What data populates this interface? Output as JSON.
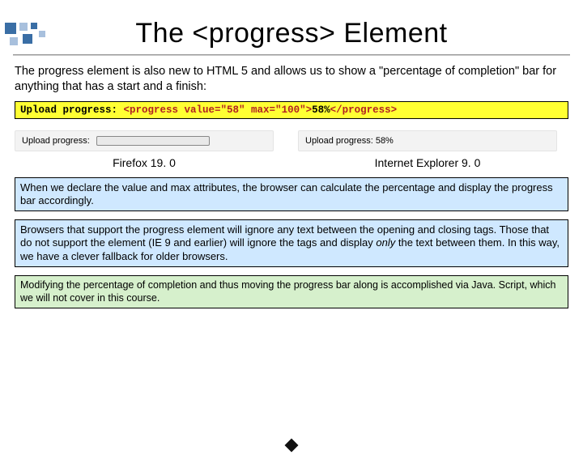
{
  "title": "The <progress> Element",
  "intro": "The progress element is also new to HTML 5 and allows us to show a \"percentage of completion\" bar for anything that has a start and a finish:",
  "code": {
    "lead": "Upload progress: ",
    "open": "<progress value=\"58\" max=\"100\">",
    "inner": "58%",
    "close": "</progress>"
  },
  "screenshots": {
    "firefox": {
      "label": "Upload progress:",
      "caption": "Firefox 19. 0"
    },
    "ie": {
      "label": "Upload progress: 58%",
      "caption": "Internet Explorer 9. 0"
    }
  },
  "box1": "When we declare the value and max attributes, the browser can calculate the percentage and display the progress bar accordingly.",
  "box2_a": "Browsers that support the progress element will ignore any text between the opening and closing tags.  Those that do not support the element (IE 9 and earlier) will ignore the tags and display ",
  "box2_em": "only",
  "box2_b": " the text between them.  In this way, we have a clever fallback for older browsers.",
  "box3": "Modifying the percentage of completion and thus moving the progress bar along is accomplished via Java. Script, which we will not cover in this course."
}
